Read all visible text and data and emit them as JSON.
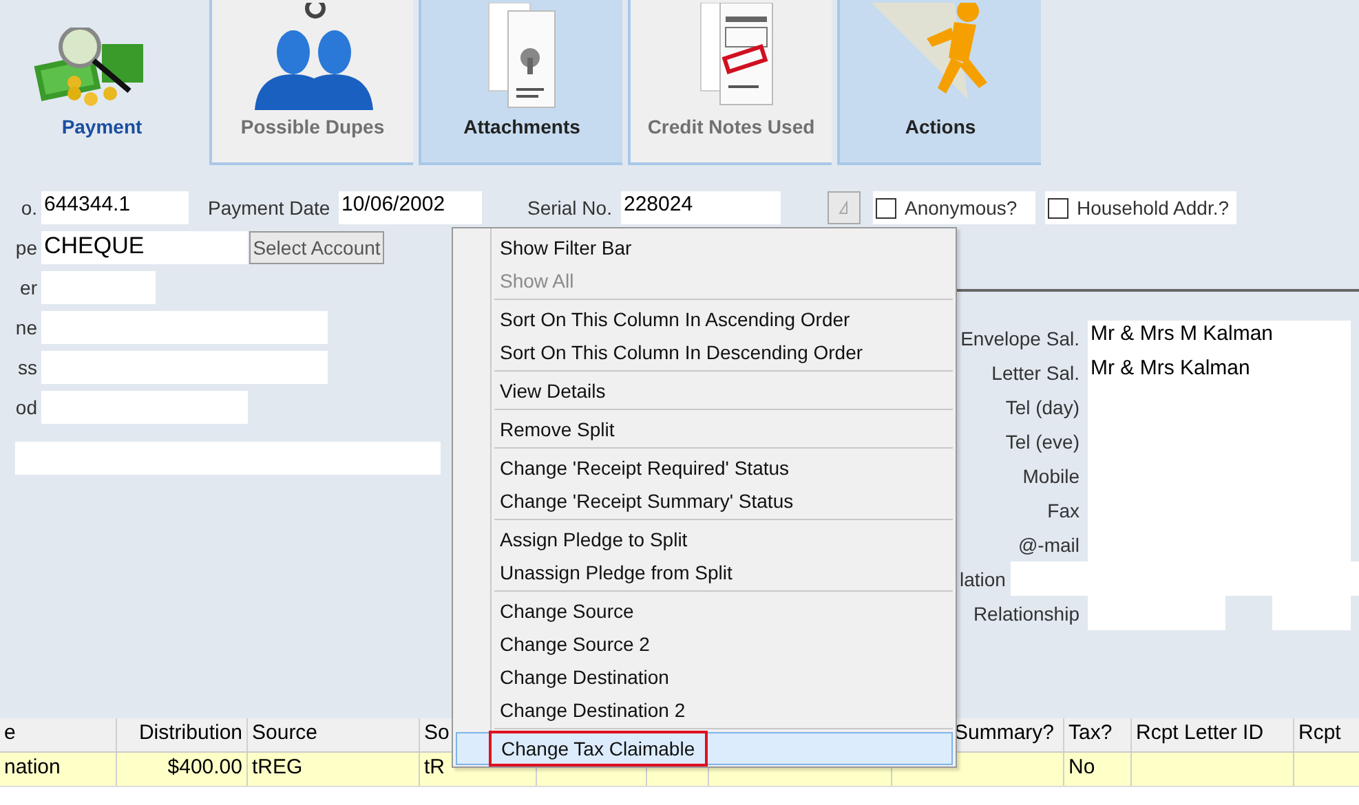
{
  "tabs": [
    {
      "label": "Payment",
      "kind": "money",
      "selected": true,
      "disabled": false
    },
    {
      "label": "Possible Dupes",
      "kind": "people",
      "selected": false,
      "disabled": true
    },
    {
      "label": "Attachments",
      "kind": "documents",
      "selected": false,
      "disabled": false
    },
    {
      "label": "Credit Notes Used",
      "kind": "invoice",
      "selected": false,
      "disabled": true
    },
    {
      "label": "Actions",
      "kind": "runner",
      "selected": false,
      "disabled": false
    }
  ],
  "header_fields": {
    "number": {
      "label": "o.",
      "value": "644344.1"
    },
    "payment_date": {
      "label": "Payment Date",
      "value": "10/06/2002"
    },
    "serial_no": {
      "label": "Serial No.",
      "value": "228024"
    },
    "checkboxes": [
      {
        "label": "Anonymous?",
        "checked": false
      },
      {
        "label": "Household Addr.?",
        "checked": false
      }
    ]
  },
  "left_fields": [
    {
      "label": "pe",
      "value": "CHEQUE",
      "button": "Select Account"
    },
    {
      "label": "er"
    },
    {
      "label": "ne"
    },
    {
      "label": "ss"
    },
    {
      "label": "od"
    }
  ],
  "right_fields": [
    {
      "label": "Envelope Sal.",
      "value": "Mr & Mrs M Kalman"
    },
    {
      "label": "Letter Sal.",
      "value": "Mr & Mrs Kalman"
    },
    {
      "label": "Tel (day)"
    },
    {
      "label": "Tel (eve)"
    },
    {
      "label": "Mobile"
    },
    {
      "label": "Fax"
    },
    {
      "label": "@-mail"
    },
    {
      "label": "lation",
      "kind": "wide"
    },
    {
      "label": "Relationship",
      "kind": "split"
    }
  ],
  "table": {
    "columns": [
      "e",
      "Distribution",
      "Source",
      "So",
      "",
      "",
      "",
      "Summary?",
      "Tax?",
      "Rcpt Letter ID",
      "Rcpt"
    ],
    "rows": [
      {
        "selected": true,
        "cells": [
          "nation",
          "$400.00",
          "tREG",
          "tR",
          null,
          null,
          null,
          null,
          "No",
          null,
          null
        ]
      }
    ]
  },
  "context_menu": {
    "groups": [
      {
        "items": [
          {
            "label": "Show Filter Bar",
            "disabled": false,
            "selected": false
          },
          {
            "label": "Show All",
            "disabled": true,
            "selected": false
          }
        ]
      },
      {
        "items": [
          {
            "label": "Sort On This Column In Ascending Order",
            "disabled": false,
            "selected": false
          },
          {
            "label": "Sort On This Column In Descending Order",
            "disabled": false,
            "selected": false
          }
        ]
      },
      {
        "items": [
          {
            "label": "View Details",
            "disabled": false,
            "selected": false
          }
        ]
      },
      {
        "items": [
          {
            "label": "Remove Split",
            "disabled": false,
            "selected": false
          }
        ]
      },
      {
        "items": [
          {
            "label": "Change 'Receipt Required' Status",
            "disabled": false,
            "selected": false
          },
          {
            "label": "Change 'Receipt Summary' Status",
            "disabled": false,
            "selected": false
          }
        ]
      },
      {
        "items": [
          {
            "label": "Assign Pledge to Split",
            "disabled": false,
            "selected": false
          },
          {
            "label": "Unassign Pledge from Split",
            "disabled": false,
            "selected": false
          }
        ]
      },
      {
        "items": [
          {
            "label": "Change Source",
            "disabled": false,
            "selected": false
          },
          {
            "label": "Change Source 2",
            "disabled": false,
            "selected": false
          },
          {
            "label": "Change Destination",
            "disabled": false,
            "selected": false
          },
          {
            "label": "Change Destination 2",
            "disabled": false,
            "selected": false
          }
        ]
      },
      {
        "items": [
          {
            "label": "Change Tax Claimable",
            "disabled": false,
            "selected": true,
            "callout": true
          }
        ]
      }
    ]
  }
}
